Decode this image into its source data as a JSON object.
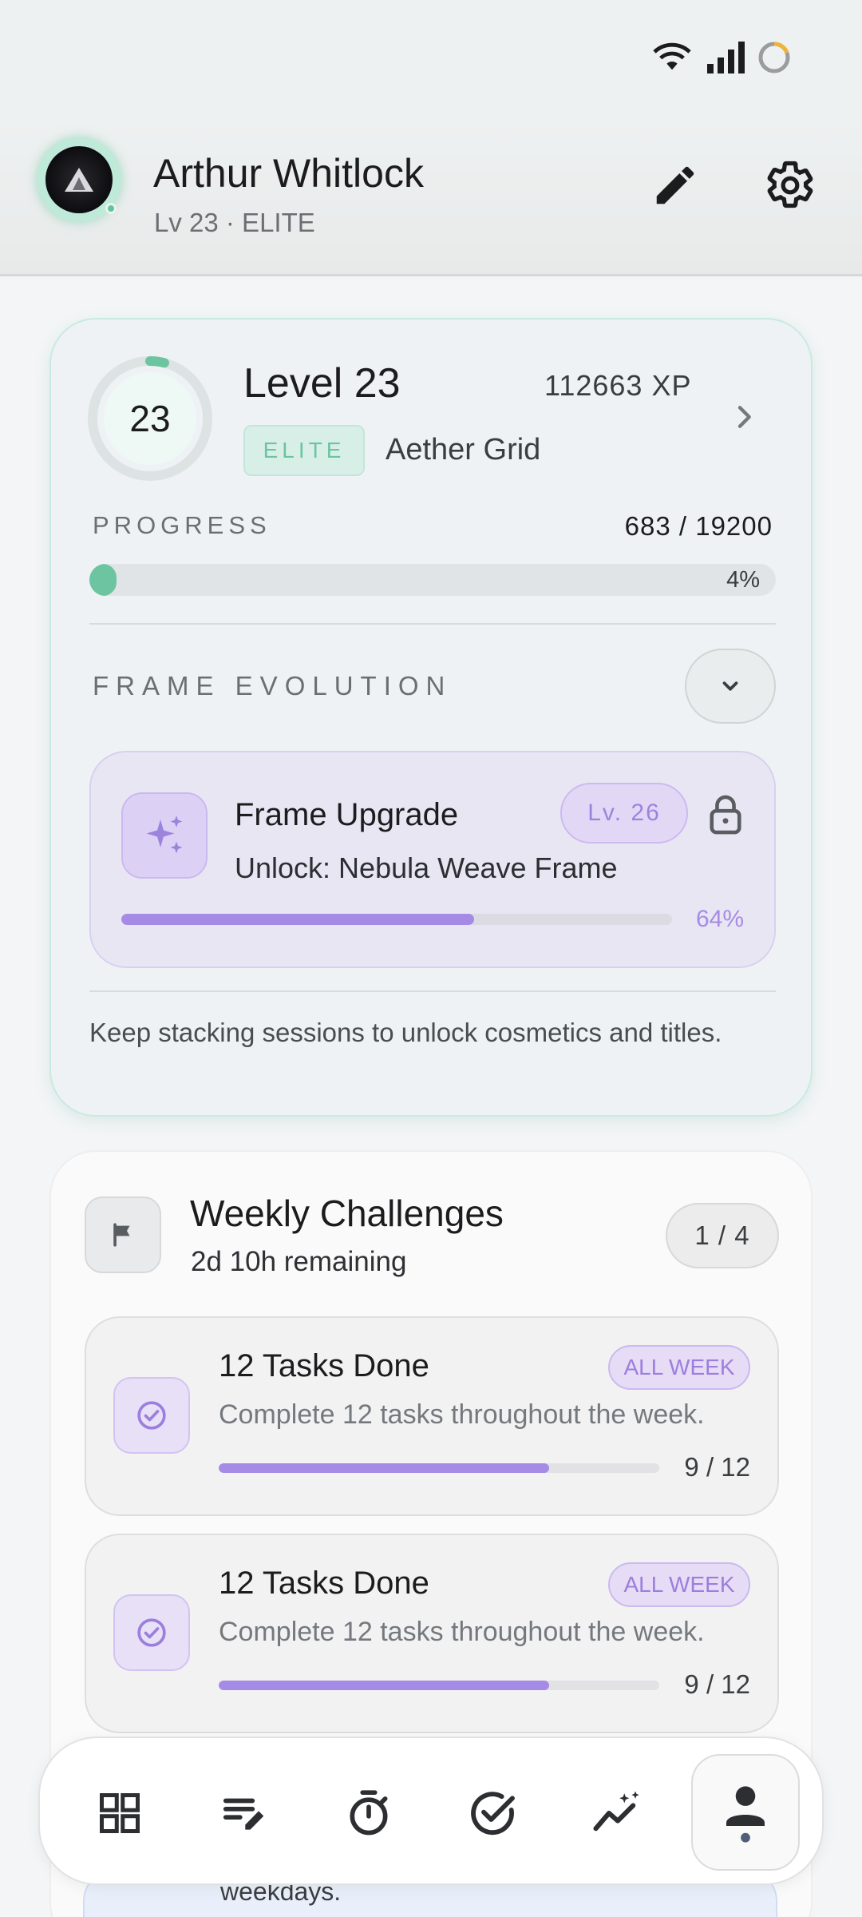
{
  "header": {
    "name": "Arthur Whitlock",
    "subtitle": "Lv 23 · ELITE"
  },
  "level_card": {
    "level_number": "23",
    "level_title": "Level 23",
    "xp": "112663 XP",
    "tier_badge": "ELITE",
    "grid_name": "Aether Grid",
    "progress_label": "PROGRESS",
    "progress_value": "683 / 19200",
    "progress_percent_text": "4%",
    "progress_fraction": 0.04,
    "frame_evolution_label": "FRAME EVOLUTION",
    "upgrade": {
      "title": "Frame Upgrade",
      "level_badge": "Lv. 26",
      "subtitle": "Unlock: Nebula Weave Frame",
      "percent_text": "64%",
      "fraction": 0.64
    },
    "footnote": "Keep stacking sessions to unlock cosmetics and titles."
  },
  "challenges": {
    "title": "Weekly Challenges",
    "remaining": "2d 10h remaining",
    "count": "1 / 4",
    "items": [
      {
        "title": "12 Tasks Done",
        "tag": "ALL WEEK",
        "description": "Complete 12 tasks throughout the week.",
        "progress_text": "9 / 12",
        "fraction": 0.75
      },
      {
        "title": "12 Tasks Done",
        "tag": "ALL WEEK",
        "description": "Complete 12 tasks throughout the week.",
        "progress_text": "9 / 12",
        "fraction": 0.75
      }
    ],
    "partial_text": "weekdays."
  },
  "nav": {
    "items": [
      "dashboard-icon",
      "notes-icon",
      "timer-icon",
      "tasks-icon",
      "stats-icon",
      "profile-icon"
    ],
    "active": "profile-icon"
  },
  "colors": {
    "accent_green": "#6cc4a0",
    "accent_purple": "#a58be6"
  }
}
